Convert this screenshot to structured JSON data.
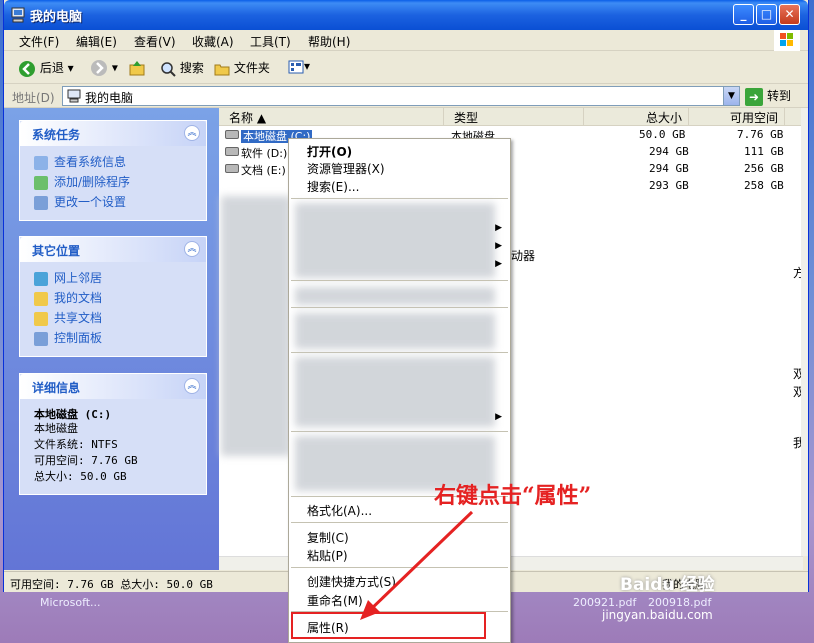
{
  "window": {
    "title": "我的电脑"
  },
  "menubar": {
    "items": [
      "文件(F)",
      "编辑(E)",
      "查看(V)",
      "收藏(A)",
      "工具(T)",
      "帮助(H)"
    ]
  },
  "toolbar": {
    "back": "后退",
    "search": "搜索",
    "folders": "文件夹"
  },
  "address": {
    "label": "地址(D)",
    "value": "我的电脑",
    "go": "转到"
  },
  "taskpane": {
    "system_tasks": {
      "title": "系统任务",
      "links": [
        "查看系统信息",
        "添加/删除程序",
        "更改一个设置"
      ]
    },
    "other_places": {
      "title": "其它位置",
      "links": [
        "网上邻居",
        "我的文档",
        "共享文档",
        "控制面板"
      ]
    },
    "details": {
      "title": "详细信息",
      "name": "本地磁盘 (C:)",
      "type": "本地磁盘",
      "fs": "文件系统: NTFS",
      "free": "可用空间: 7.76 GB",
      "total": "总大小: 50.0 GB"
    }
  },
  "columns": [
    "名称",
    "类型",
    "总大小",
    "可用空间"
  ],
  "drives": [
    {
      "name": "本地磁盘 (C:)",
      "type": "本地磁盘",
      "total": "50.0 GB",
      "free": "7.76 GB"
    },
    {
      "name": "软件 (D:)",
      "total": "294 GB",
      "free": "111 GB"
    },
    {
      "name": "文档 (E:)",
      "total": "294 GB",
      "free": "256 GB"
    },
    {
      "name": "",
      "total": "293 GB",
      "free": "258 GB"
    }
  ],
  "partial_text": {
    "device": "动器",
    "r1": "方",
    "r2": "双",
    "r3": "双",
    "r4": "我"
  },
  "context_menu": {
    "open": "打开(O)",
    "explorer": "资源管理器(X)",
    "search": "搜索(E)...",
    "format": "格式化(A)...",
    "copy": "复制(C)",
    "paste": "粘贴(P)",
    "shortcut": "创建快捷方式(S)",
    "rename": "重命名(M)",
    "properties": "属性(R)"
  },
  "statusbar": {
    "text": "可用空间: 7.76 GB 总大小: 50.0 GB",
    "right": "我的电脑"
  },
  "annotation": {
    "text": "右键点击“属性”"
  },
  "desktop": {
    "labels": [
      "Microsoft...",
      "200921.pdf",
      "200918.pdf"
    ]
  },
  "watermark": {
    "text": "Baidu 经验",
    "url": "jingyan.baidu.com"
  },
  "colors": {
    "accent": "#e52222",
    "title_blue": "#0a4fd4",
    "link_blue": "#215dc6"
  }
}
